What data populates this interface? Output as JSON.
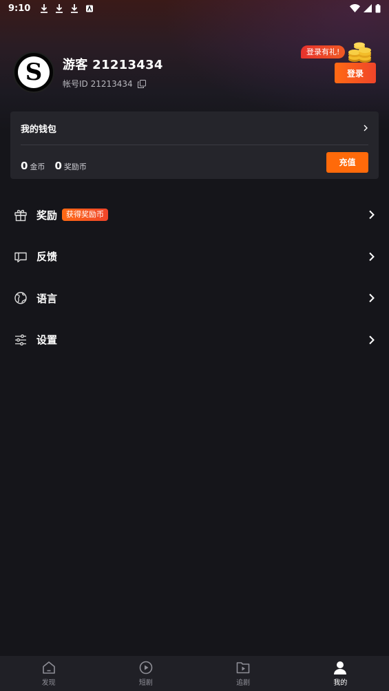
{
  "status_bar": {
    "time": "9:10",
    "left_icons": [
      "download-icon",
      "download-icon",
      "download-icon",
      "app-notification-icon"
    ],
    "right_icons": [
      "wifi-icon",
      "signal-icon",
      "battery-icon"
    ]
  },
  "profile": {
    "avatar_letter": "S",
    "username": "游客 21213434",
    "account_id": "帐号ID 21213434",
    "login_badge": "登录有礼!",
    "login_button": "登录"
  },
  "wallet": {
    "title": "我的钱包",
    "coins_value": "0",
    "coins_label": "金币",
    "reward_value": "0",
    "reward_label": "奖励币",
    "recharge_button": "充值"
  },
  "menu": {
    "items": [
      {
        "label": "奖励",
        "icon": "gift-icon",
        "badge": "获得奖励币"
      },
      {
        "label": "反馈",
        "icon": "feedback-icon"
      },
      {
        "label": "语言",
        "icon": "globe-icon"
      },
      {
        "label": "设置",
        "icon": "settings-sliders-icon"
      }
    ]
  },
  "bottom_nav": {
    "items": [
      {
        "label": "发现",
        "icon": "home-icon"
      },
      {
        "label": "短剧",
        "icon": "play-circle-icon"
      },
      {
        "label": "追剧",
        "icon": "folder-play-icon"
      },
      {
        "label": "我的",
        "icon": "person-icon",
        "active": true
      }
    ]
  },
  "colors": {
    "background": "#15151a",
    "card": "#25252b",
    "accent": "#ff6a0a",
    "bottom_nav": "#202026"
  }
}
